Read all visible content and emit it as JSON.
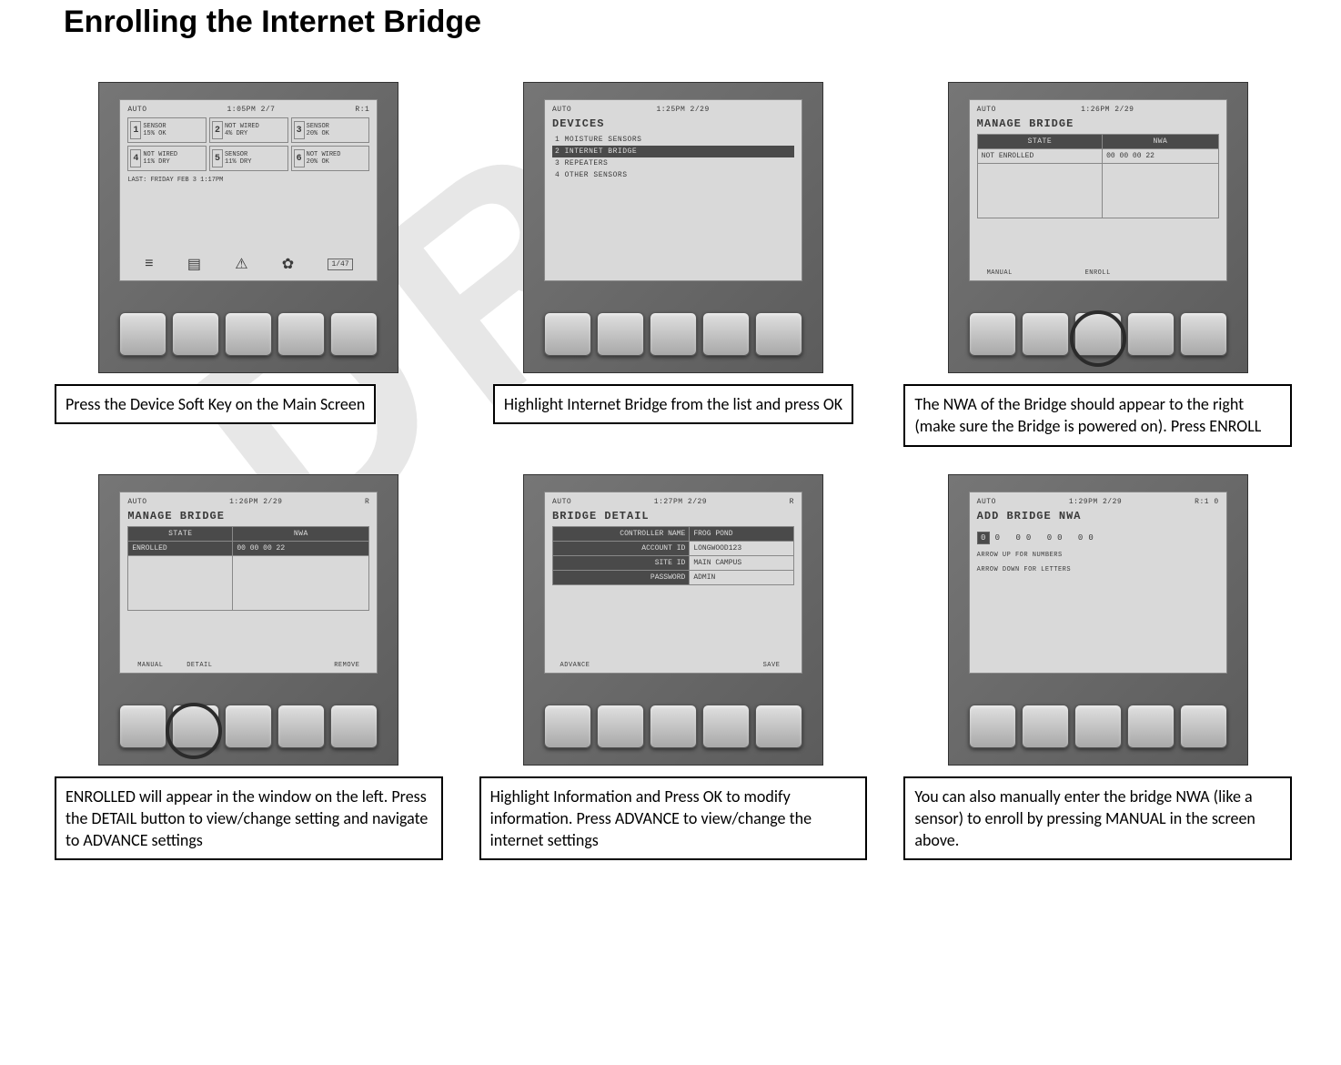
{
  "title": "Enrolling the Internet Bridge",
  "steps": [
    {
      "caption": "Press the Device Soft Key on the Main Screen",
      "screen": {
        "mode": "AUTO",
        "clock": "1:05PM 2/7",
        "rcol": "R:1",
        "sensors": [
          {
            "n": "1",
            "t1": "SENSOR",
            "t2": "15% OK"
          },
          {
            "n": "2",
            "t1": "NOT WIRED",
            "t2": "4% DRY"
          },
          {
            "n": "3",
            "t1": "SENSOR",
            "t2": "20% OK"
          },
          {
            "n": "4",
            "t1": "NOT WIRED",
            "t2": "11% DRY"
          },
          {
            "n": "5",
            "t1": "SENSOR",
            "t2": "11% DRY"
          },
          {
            "n": "6",
            "t1": "NOT WIRED",
            "t2": "20% OK"
          }
        ],
        "last_line": "LAST: FRIDAY   FEB 3   1:17PM",
        "icons": [
          "≡",
          "▤",
          "⚠",
          "✿",
          "1/47"
        ]
      }
    },
    {
      "caption": "Highlight Internet Bridge from the list and press OK",
      "screen": {
        "mode": "AUTO",
        "clock": "1:25PM 2/29",
        "title": "DEVICES",
        "list": [
          {
            "label": "1 MOISTURE SENSORS",
            "selected": false
          },
          {
            "label": "2 INTERNET BRIDGE",
            "selected": true
          },
          {
            "label": "3 REPEATERS",
            "selected": false
          },
          {
            "label": "4 OTHER SENSORS",
            "selected": false
          }
        ]
      }
    },
    {
      "caption": "The NWA of the Bridge should appear to the right (make sure the Bridge is powered on). Press ENROLL",
      "screen": {
        "mode": "AUTO",
        "clock": "1:26PM 2/29",
        "title": "MANAGE BRIDGE",
        "cols": [
          "STATE",
          "NWA"
        ],
        "row": [
          "NOT ENROLLED",
          "00 00 00 22"
        ],
        "softkeys": [
          "MANUAL",
          "",
          "ENROLL",
          "",
          ""
        ]
      }
    },
    {
      "caption": "ENROLLED will appear in the window on the left. Press the DETAIL button to view/change setting and navigate to ADVANCE settings",
      "screen": {
        "mode": "AUTO",
        "clock": "1:26PM 2/29",
        "rcol": "R",
        "title": "MANAGE BRIDGE",
        "cols": [
          "STATE",
          "NWA"
        ],
        "row": [
          "ENROLLED",
          "00 00 00 22"
        ],
        "softkeys": [
          "MANUAL",
          "DETAIL",
          "",
          "",
          "REMOVE"
        ]
      }
    },
    {
      "caption": "Highlight Information and Press OK to modify information. Press ADVANCE to view/change the internet settings",
      "screen": {
        "mode": "AUTO",
        "clock": "1:27PM 2/29",
        "rcol": "R",
        "title": "BRIDGE DETAIL",
        "rows": [
          [
            "CONTROLLER NAME",
            "FROG POND"
          ],
          [
            "ACCOUNT ID",
            "LONGWOOD123"
          ],
          [
            "SITE ID",
            "MAIN CAMPUS"
          ],
          [
            "PASSWORD",
            "ADMIN"
          ]
        ],
        "softkeys": [
          "ADVANCE",
          "",
          "",
          "",
          "SAVE"
        ]
      }
    },
    {
      "caption": "You can also manually enter the bridge NWA (like a sensor) to enroll by pressing MANUAL in the screen above.",
      "screen": {
        "mode": "AUTO",
        "clock": "1:29PM 2/29",
        "rcol": "R:1  0",
        "title": "ADD BRIDGE NWA",
        "nwa_digits": [
          "0",
          "0",
          "0",
          "0",
          "0",
          "0",
          "0",
          "0"
        ],
        "hint1": "ARROW UP FOR NUMBERS",
        "hint2": "ARROW DOWN FOR LETTERS"
      }
    }
  ]
}
